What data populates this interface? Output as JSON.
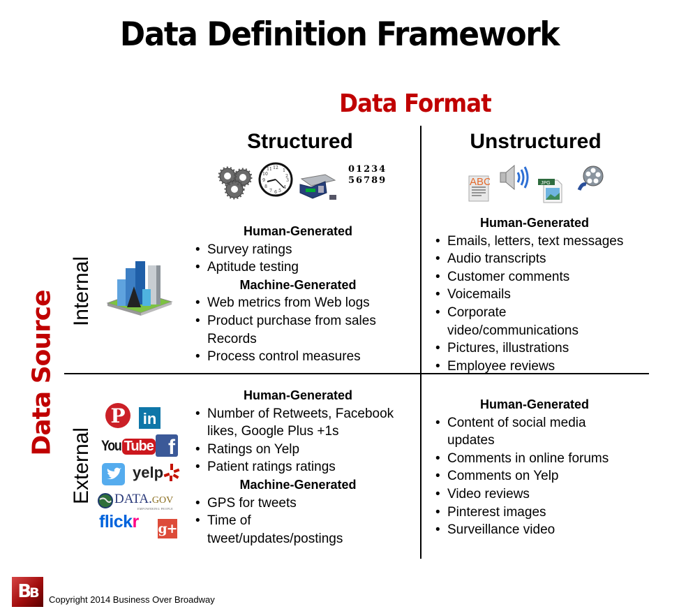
{
  "title": "Data Definition Framework",
  "axes": {
    "format_title": "Data Format",
    "source_title": "Data Source",
    "columns": [
      "Structured",
      "Unstructured"
    ],
    "rows": [
      "Internal",
      "External"
    ]
  },
  "structured_icons": [
    "gears-icon",
    "clock-icon",
    "scale-icon",
    "numbers-icon"
  ],
  "structured_numbers": {
    "line1": "01234",
    "line2": "56789"
  },
  "unstructured_icons": [
    "text-document-icon",
    "speaker-audio-icon",
    "jpg-file-icon",
    "film-reel-icon"
  ],
  "unstructured_labels": {
    "abc": "ABC",
    "jpg": "JPG"
  },
  "internal_icon": "city-buildings-icon",
  "external_logos": {
    "pinterest": "P",
    "linkedin": "in",
    "youtube_you": "You",
    "youtube_tube": "Tube",
    "facebook": "f",
    "twitter": "twitter-bird",
    "yelp": "yelp",
    "datagov_main": "DATA.",
    "datagov_gov": "GOV",
    "datagov_tag": "EMPOWERING PEOPLE",
    "flickr_flick": "flick",
    "flickr_r": "r",
    "googleplus": "g+"
  },
  "cells": {
    "internal_structured": {
      "groups": [
        {
          "heading": "Human-Generated",
          "items": [
            "Survey ratings",
            "Aptitude testing"
          ]
        },
        {
          "heading": "Machine-Generated",
          "items": [
            "Web metrics from Web logs",
            "Product purchase from sales Records",
            "Process control measures"
          ]
        }
      ]
    },
    "internal_unstructured": {
      "groups": [
        {
          "heading": "Human-Generated",
          "items": [
            "Emails, letters, text messages",
            "Audio transcripts",
            "Customer comments",
            "Voicemails",
            "Corporate video/communications",
            "Pictures, illustrations",
            "Employee reviews"
          ]
        }
      ]
    },
    "external_structured": {
      "groups": [
        {
          "heading": "Human-Generated",
          "items": [
            "Number of Retweets, Facebook likes, Google Plus +1s",
            "Ratings on Yelp",
            "Patient ratings ratings"
          ]
        },
        {
          "heading": "Machine-Generated",
          "items": [
            "GPS for tweets",
            "Time of tweet/updates/postings"
          ]
        }
      ]
    },
    "external_unstructured": {
      "groups": [
        {
          "heading": "Human-Generated",
          "items": [
            "Content of social media updates",
            "Comments in online forums",
            "Comments on Yelp",
            "Video reviews",
            "Pinterest images",
            "Surveillance video"
          ]
        }
      ]
    }
  },
  "footer": {
    "logo_text_b1": "B",
    "logo_text_b2": "B",
    "copyright": "Copyright 2014 Business Over Broadway"
  },
  "colors": {
    "accent": "#c00000",
    "text": "#000000",
    "background": "#ffffff"
  }
}
